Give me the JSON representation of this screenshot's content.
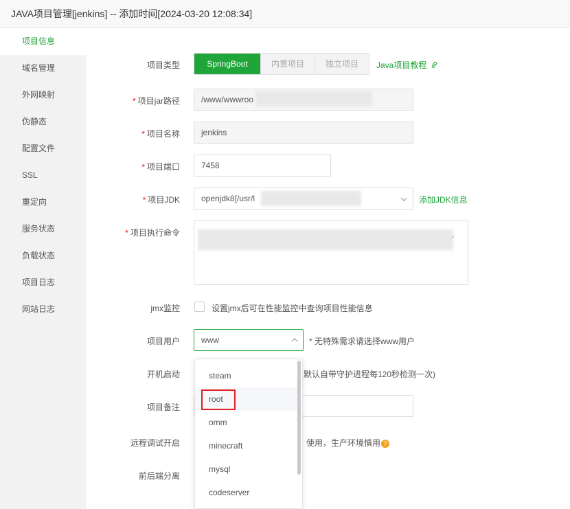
{
  "window": {
    "title": "JAVA项目管理[jenkins] -- 添加时间[2024-03-20 12:08:34]"
  },
  "sidebar": {
    "items": [
      {
        "label": "项目信息",
        "active": true
      },
      {
        "label": "域名管理"
      },
      {
        "label": "外网映射"
      },
      {
        "label": "伪静态"
      },
      {
        "label": "配置文件"
      },
      {
        "label": "SSL"
      },
      {
        "label": "重定向"
      },
      {
        "label": "服务状态"
      },
      {
        "label": "负载状态"
      },
      {
        "label": "项目日志"
      },
      {
        "label": "网站日志"
      }
    ]
  },
  "form": {
    "type": {
      "label": "项目类型",
      "options": [
        "SpringBoot",
        "内置项目",
        "独立项目"
      ],
      "selected": "SpringBoot",
      "tutorial_link": "Java项目教程"
    },
    "jar_path": {
      "label": "项目jar路径",
      "value": "/www/wwwroo"
    },
    "name": {
      "label": "项目名称",
      "value": "jenkins"
    },
    "port": {
      "label": "项目端口",
      "value": "7458"
    },
    "jdk": {
      "label": "项目JDK",
      "value": "openjdk8[/usr/l",
      "add_link": "添加JDK信息"
    },
    "command": {
      "label": "项目执行命令",
      "visible_fragment": "..jdk1.8/bin/java -jar .. ,",
      "trail": ","
    },
    "jmx": {
      "label": "jmx监控",
      "checkbox_label": "设置jmx后可在性能监控中查询项目性能信息"
    },
    "user": {
      "label": "项目用户",
      "value": "www",
      "hint": "* 无特殊需求请选择www用户"
    },
    "autostart": {
      "label": "开机启动",
      "hint_partial": "默认自带守护进程每120秒检测一次)"
    },
    "remark": {
      "label": "项目备注"
    },
    "remote_debug": {
      "label": "远程调试开启",
      "hint_partial": "、使用，生产环境慎用"
    },
    "separation": {
      "label": "前后端分离"
    }
  },
  "user_dropdown": {
    "options": [
      "steam",
      "root",
      "omm",
      "minecraft",
      "mysql",
      "codeserver"
    ],
    "highlighted": "root"
  },
  "colors": {
    "accent": "#20a53a",
    "required": "#ef0808",
    "highlight_box": "#e02020",
    "help": "#f0a020"
  }
}
